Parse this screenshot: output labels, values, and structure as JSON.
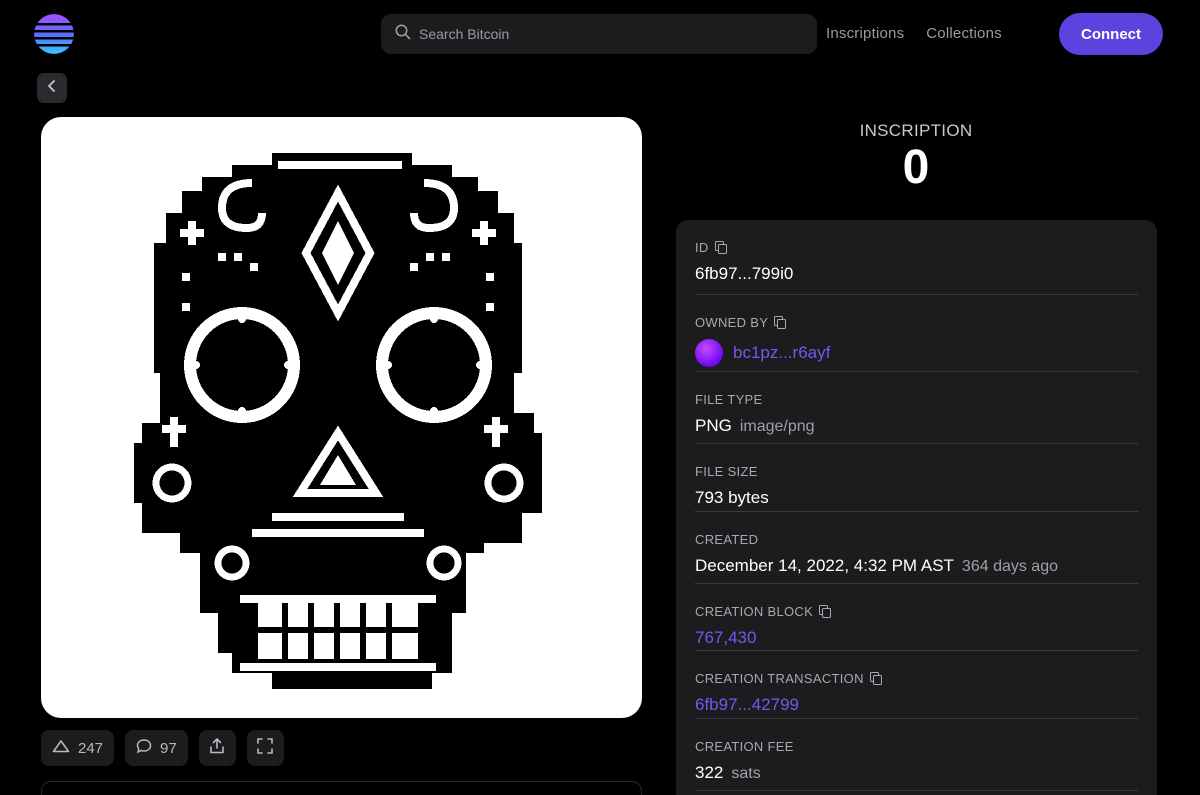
{
  "header": {
    "search_placeholder": "Search Bitcoin",
    "nav": [
      "Inscriptions",
      "Collections"
    ],
    "connect_label": "Connect"
  },
  "actions": {
    "likes": "247",
    "comments": "97"
  },
  "inscription": {
    "label": "INSCRIPTION",
    "number": "0"
  },
  "details": {
    "id_label": "ID",
    "id_value": "6fb97...799i0",
    "owned_by_label": "OWNED BY",
    "owned_by_value": "bc1pz...r6ayf",
    "file_type_label": "FILE TYPE",
    "file_type_value": "PNG",
    "file_type_mime": "image/png",
    "file_size_label": "FILE SIZE",
    "file_size_value": "793 bytes",
    "created_label": "CREATED",
    "created_value": "December 14, 2022, 4:32 PM AST",
    "created_relative": "364 days ago",
    "creation_block_label": "CREATION BLOCK",
    "creation_block_value": "767,430",
    "creation_tx_label": "CREATION TRANSACTION",
    "creation_tx_value": "6fb97...42799",
    "creation_fee_label": "CREATION FEE",
    "creation_fee_value": "322",
    "creation_fee_unit": "sats"
  },
  "colors": {
    "accent": "#5b43e0",
    "link": "#6d5bf0",
    "panel": "#1c1c1f"
  }
}
